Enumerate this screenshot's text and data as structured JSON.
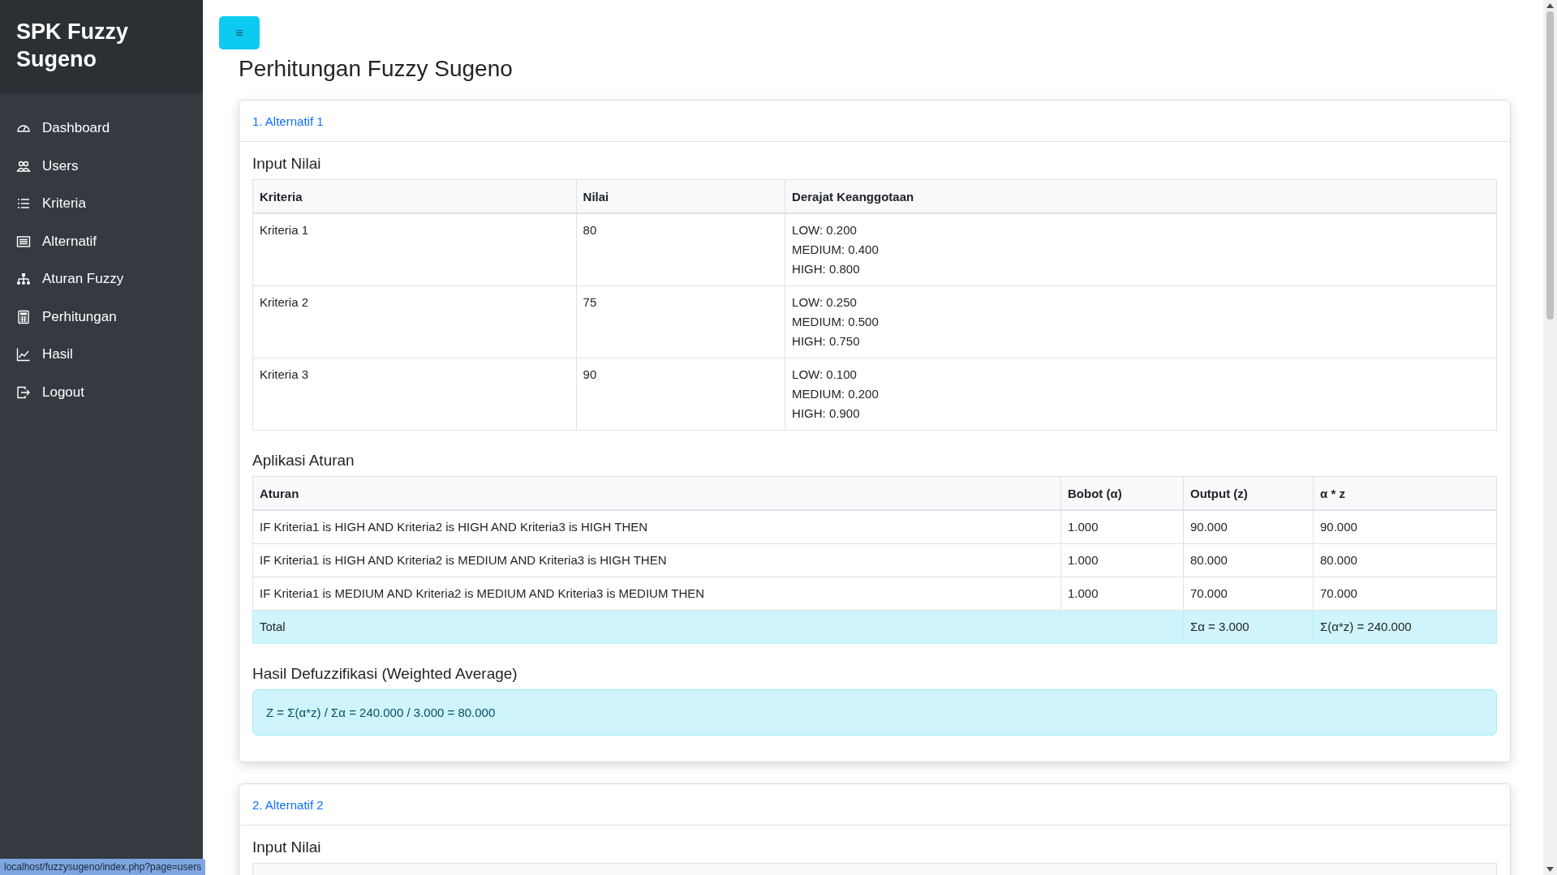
{
  "sidebar": {
    "brand": "SPK Fuzzy Sugeno",
    "items": [
      {
        "label": "Dashboard"
      },
      {
        "label": "Users"
      },
      {
        "label": "Kriteria"
      },
      {
        "label": "Alternatif"
      },
      {
        "label": "Aturan Fuzzy"
      },
      {
        "label": "Perhitungan"
      },
      {
        "label": "Hasil"
      },
      {
        "label": "Logout"
      }
    ]
  },
  "toggle_button": {
    "label": "≡"
  },
  "page_title": "Perhitungan Fuzzy Sugeno",
  "alternatives": [
    {
      "title": "1. Alternatif 1",
      "input_title": "Input Nilai",
      "criteria_table": {
        "columns": [
          "Kriteria",
          "Nilai",
          "Derajat Keanggotaan"
        ],
        "rows": [
          {
            "criterion": "Kriteria 1",
            "value": "80",
            "degrees": [
              "LOW: 0.200",
              "MEDIUM: 0.400",
              "HIGH: 0.800"
            ]
          },
          {
            "criterion": "Kriteria 2",
            "value": "75",
            "degrees": [
              "LOW: 0.250",
              "MEDIUM: 0.500",
              "HIGH: 0.750"
            ]
          },
          {
            "criterion": "Kriteria 3",
            "value": "90",
            "degrees": [
              "LOW: 0.100",
              "MEDIUM: 0.200",
              "HIGH: 0.900"
            ]
          }
        ]
      },
      "rules_title": "Aplikasi Aturan",
      "rules_table": {
        "columns": [
          "Aturan",
          "Bobot (α)",
          "Output (z)",
          "α * z"
        ],
        "rows": [
          [
            "IF Kriteria1 is HIGH AND Kriteria2 is HIGH AND Kriteria3 is HIGH THEN",
            "1.000",
            "90.000",
            "90.000"
          ],
          [
            "IF Kriteria1 is HIGH AND Kriteria2 is MEDIUM AND Kriteria3 is HIGH THEN",
            "1.000",
            "80.000",
            "80.000"
          ],
          [
            "IF Kriteria1 is MEDIUM AND Kriteria2 is MEDIUM AND Kriteria3 is MEDIUM THEN",
            "1.000",
            "70.000",
            "70.000"
          ]
        ],
        "total": {
          "label": "Total",
          "sum_alpha": "Σα = 3.000",
          "sum_az": "Σ(α*z) = 240.000"
        }
      },
      "defuzz_title": "Hasil Defuzzifikasi (Weighted Average)",
      "result": "Z = Σ(α*z) / Σα = 240.000 / 3.000 = 80.000"
    },
    {
      "title": "2. Alternatif 2",
      "input_title": "Input Nilai"
    }
  ],
  "status_url": "localhost/fuzzysugeno/index.php?page=users"
}
